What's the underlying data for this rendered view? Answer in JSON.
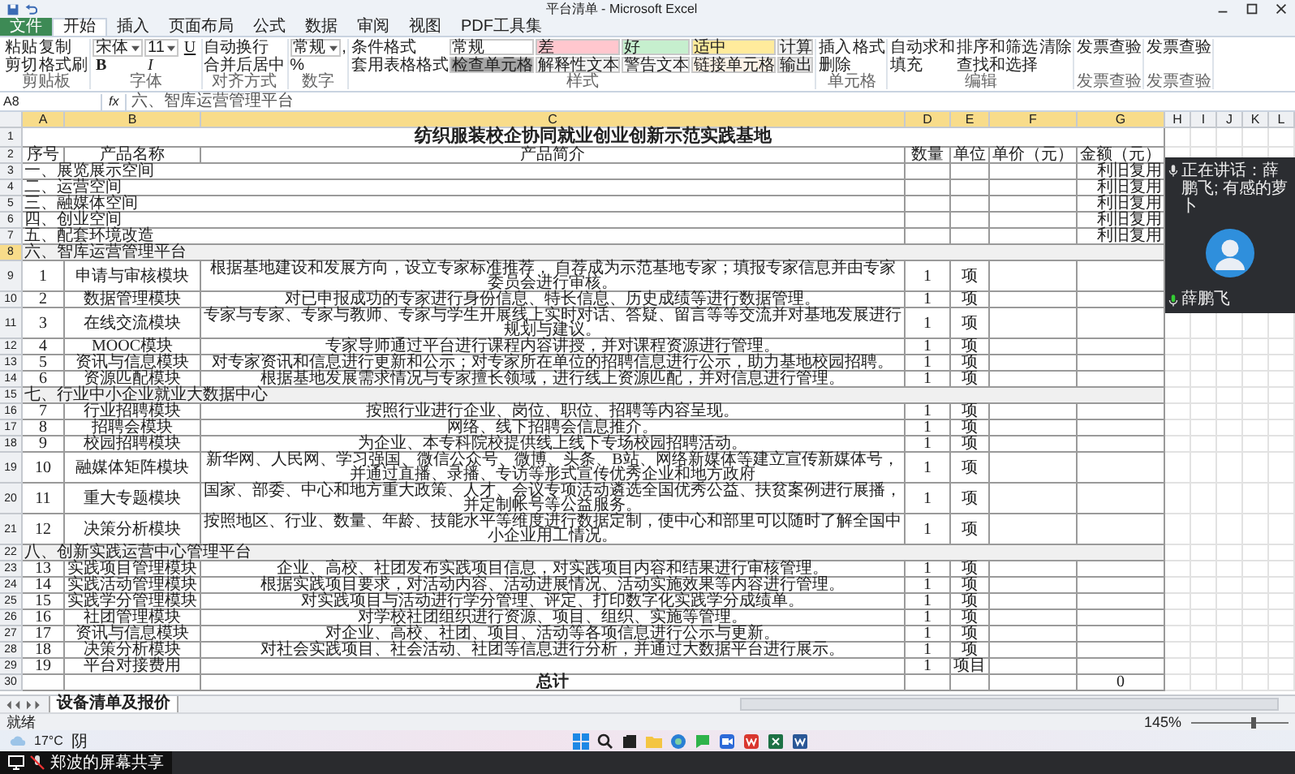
{
  "window": {
    "title": "平台清单 - Microsoft Excel"
  },
  "tabs": [
    {
      "label": "文件",
      "kind": "file",
      "selected": false
    },
    {
      "label": "开始",
      "kind": "tab",
      "selected": true
    },
    {
      "label": "插入",
      "kind": "tab",
      "selected": false
    },
    {
      "label": "页面布局",
      "kind": "tab",
      "selected": false
    },
    {
      "label": "公式",
      "kind": "tab",
      "selected": false
    },
    {
      "label": "数据",
      "kind": "tab",
      "selected": false
    },
    {
      "label": "审阅",
      "kind": "tab",
      "selected": false
    },
    {
      "label": "视图",
      "kind": "tab",
      "selected": false
    },
    {
      "label": "PDF工具集",
      "kind": "tab",
      "selected": false
    }
  ],
  "ribbon": {
    "groups": [
      {
        "label": "剪贴板",
        "items": [
          {
            "label": "粘贴",
            "kind": "button"
          },
          {
            "label": "剪切",
            "kind": "button"
          },
          {
            "label": "复制",
            "kind": "button"
          },
          {
            "label": "格式刷",
            "kind": "button"
          }
        ]
      },
      {
        "label": "字体",
        "items": [
          {
            "label": "宋体",
            "kind": "dropdown"
          },
          {
            "label": "B",
            "kind": "bold"
          },
          {
            "label": "11",
            "kind": "dropdown"
          },
          {
            "label": "I",
            "kind": "italic"
          },
          {
            "label": "U",
            "kind": "underline"
          }
        ]
      },
      {
        "label": "对齐方式",
        "items": [
          {
            "label": "自动换行",
            "kind": "button"
          },
          {
            "label": "合并后居中",
            "kind": "button"
          }
        ]
      },
      {
        "label": "数字",
        "items": [
          {
            "label": "常规",
            "kind": "dropdown"
          },
          {
            "label": "%",
            "kind": "button"
          },
          {
            "label": ",",
            "kind": "button"
          }
        ]
      },
      {
        "label": "样式",
        "items": [
          {
            "label": "条件格式",
            "kind": "button"
          },
          {
            "label": "套用表格格式",
            "kind": "button"
          },
          {
            "label": "常规",
            "kind": "style",
            "color": "#ffffff"
          },
          {
            "label": "检查单元格",
            "kind": "style",
            "color": "#a5a5a5"
          },
          {
            "label": "差",
            "kind": "style",
            "color": "#ffc7ce"
          },
          {
            "label": "解释性文本",
            "kind": "style",
            "color": "#f4f4f4"
          },
          {
            "label": "好",
            "kind": "style",
            "color": "#c6efce"
          },
          {
            "label": "警告文本",
            "kind": "style",
            "color": "#fafafa"
          },
          {
            "label": "适中",
            "kind": "style",
            "color": "#ffeb9c"
          },
          {
            "label": "链接单元格",
            "kind": "style",
            "color": "#fdf3e7"
          },
          {
            "label": "计算",
            "kind": "style",
            "color": "#f2f2f2"
          },
          {
            "label": "输出",
            "kind": "style",
            "color": "#e7e6e6"
          }
        ]
      },
      {
        "label": "单元格",
        "items": [
          {
            "label": "插入",
            "kind": "button"
          },
          {
            "label": "删除",
            "kind": "button"
          },
          {
            "label": "格式",
            "kind": "button"
          }
        ]
      },
      {
        "label": "编辑",
        "items": [
          {
            "label": "自动求和",
            "kind": "button"
          },
          {
            "label": "填充",
            "kind": "button"
          },
          {
            "label": "排序和筛选",
            "kind": "button"
          },
          {
            "label": "查找和选择",
            "kind": "button"
          },
          {
            "label": "清除",
            "kind": "button"
          }
        ]
      },
      {
        "label": "发票查验",
        "items": [
          {
            "label": "发票查验",
            "kind": "button"
          }
        ]
      },
      {
        "label": "发票查验",
        "items": [
          {
            "label": "发票查验",
            "kind": "button"
          }
        ]
      }
    ]
  },
  "formula_bar": {
    "name_box": "A8",
    "fx": "fx",
    "content": "六、智库运营管理平台"
  },
  "columns": [
    {
      "label": "A",
      "selected": true
    },
    {
      "label": "B",
      "selected": true
    },
    {
      "label": "C",
      "selected": true
    },
    {
      "label": "D",
      "selected": true
    },
    {
      "label": "E",
      "selected": true
    },
    {
      "label": "F",
      "selected": true
    },
    {
      "label": "G",
      "selected": true
    },
    {
      "label": "H",
      "selected": false
    },
    {
      "label": "I",
      "selected": false
    },
    {
      "label": "J",
      "selected": false
    },
    {
      "label": "K",
      "selected": false
    },
    {
      "label": "L",
      "selected": false
    }
  ],
  "rows": [
    {
      "num": "1",
      "kind": "title",
      "selected": false,
      "title": "纺织服装校企协同就业创业创新示范实践基地"
    },
    {
      "num": "2",
      "kind": "header",
      "selected": false,
      "a": "序号",
      "b": "产品名称",
      "c": "产品简介",
      "d": "数量",
      "e": "单位",
      "f": "单价（元）",
      "g": "金额（元）"
    },
    {
      "num": "3",
      "kind": "space",
      "selected": false,
      "a": "一、展览展示空间",
      "g": "利旧复用"
    },
    {
      "num": "4",
      "kind": "space",
      "selected": false,
      "a": "二、运营空间",
      "g": "利旧复用"
    },
    {
      "num": "5",
      "kind": "space",
      "selected": false,
      "a": "三、融媒体空间",
      "g": "利旧复用"
    },
    {
      "num": "6",
      "kind": "space",
      "selected": false,
      "a": "四、创业空间",
      "g": "利旧复用"
    },
    {
      "num": "7",
      "kind": "space",
      "selected": false,
      "a": "五、配套环境改造",
      "g": "利旧复用"
    },
    {
      "num": "8",
      "kind": "platform",
      "selected": true,
      "a": "六、智库运营管理平台"
    },
    {
      "num": "9",
      "kind": "item",
      "selected": false,
      "a": "1",
      "b": "申请与审核模块",
      "c": "根据基地建设和发展方向，设立专家标准推荐， 自荐成为示范基地专家；填报专家信息并由专家委员会进行审核。",
      "d": "1",
      "e": "项"
    },
    {
      "num": "10",
      "kind": "item",
      "selected": false,
      "a": "2",
      "b": "数据管理模块",
      "c": "对已申报成功的专家进行身份信息、特长信息、历史成绩等进行数据管理。",
      "d": "1",
      "e": "项"
    },
    {
      "num": "11",
      "kind": "item",
      "selected": false,
      "a": "3",
      "b": "在线交流模块",
      "c": "专家与专家、专家与教师、专家与学生开展线上实时对话、答疑、留言等等交流并对基地发展进行规划与建议。",
      "d": "1",
      "e": "项"
    },
    {
      "num": "12",
      "kind": "item",
      "selected": false,
      "a": "4",
      "b": "MOOC模块",
      "c": "专家导师通过平台进行课程内容讲授，并对课程资源进行管理。",
      "d": "1",
      "e": "项"
    },
    {
      "num": "13",
      "kind": "item",
      "selected": false,
      "a": "5",
      "b": "资讯与信息模块",
      "c": "对专家资讯和信息进行更新和公示；对专家所在单位的招聘信息进行公示，助力基地校园招聘。",
      "d": "1",
      "e": "项"
    },
    {
      "num": "14",
      "kind": "item",
      "selected": false,
      "a": "6",
      "b": "资源匹配模块",
      "c": "根据基地发展需求情况与专家擅长领域，进行线上资源匹配，并对信息进行管理。",
      "d": "1",
      "e": "项"
    },
    {
      "num": "15",
      "kind": "platform",
      "selected": false,
      "a": "七、行业中小企业就业大数据中心"
    },
    {
      "num": "16",
      "kind": "item",
      "selected": false,
      "a": "7",
      "b": "行业招聘模块",
      "c": "按照行业进行企业、岗位、职位、招聘等内容呈现。",
      "d": "1",
      "e": "项"
    },
    {
      "num": "17",
      "kind": "item",
      "selected": false,
      "a": "8",
      "b": "招聘会模块",
      "c": "网络、线下招聘会信息推介。",
      "d": "1",
      "e": "项"
    },
    {
      "num": "18",
      "kind": "item",
      "selected": false,
      "a": "9",
      "b": "校园招聘模块",
      "c": "为企业、本专科院校提供线上线下专场校园招聘活动。",
      "d": "1",
      "e": "项"
    },
    {
      "num": "19",
      "kind": "item",
      "selected": false,
      "a": "10",
      "b": "融媒体矩阵模块",
      "c": "新华网、人民网、学习强国、微信公众号、微博、头条、B站、网络新媒体等建立宣传新媒体号，并通过直播、录播、专访等形式宣传优秀企业和地方政府",
      "d": "1",
      "e": "项"
    },
    {
      "num": "20",
      "kind": "item",
      "selected": false,
      "a": "11",
      "b": "重大专题模块",
      "c": "国家、部委、中心和地方重大政策、人才、会议专项活动遴选全国优秀公益、扶贫案例进行展播，并定制帐号等公益服务。",
      "d": "1",
      "e": "项"
    },
    {
      "num": "21",
      "kind": "item",
      "selected": false,
      "a": "12",
      "b": "决策分析模块",
      "c": "按照地区、行业、数量、年龄、技能水平等维度进行数据定制，使中心和部里可以随时了解全国中小企业用工情况。",
      "d": "1",
      "e": "项"
    },
    {
      "num": "22",
      "kind": "platform",
      "selected": false,
      "a": "八、创新实践运营中心管理平台"
    },
    {
      "num": "23",
      "kind": "item",
      "selected": false,
      "a": "13",
      "b": "实践项目管理模块",
      "c": "企业、高校、社团发布实践项目信息，对实践项目内容和结果进行审核管理。",
      "d": "1",
      "e": "项"
    },
    {
      "num": "24",
      "kind": "item",
      "selected": false,
      "a": "14",
      "b": "实践活动管理模块",
      "c": "根据实践项目要求，对活动内容、活动进展情况、活动实施效果等内容进行管理。",
      "d": "1",
      "e": "项"
    },
    {
      "num": "25",
      "kind": "item",
      "selected": false,
      "a": "15",
      "b": "实践学分管理模块",
      "c": "对实践项目与活动进行学分管理、评定、打印数字化实践学分成绩单。",
      "d": "1",
      "e": "项"
    },
    {
      "num": "26",
      "kind": "item",
      "selected": false,
      "a": "16",
      "b": "社团管理模块",
      "c": "对学校社团组织进行资源、项目、组织、实施等管理。",
      "d": "1",
      "e": "项"
    },
    {
      "num": "27",
      "kind": "item",
      "selected": false,
      "a": "17",
      "b": "资讯与信息模块",
      "c": "对企业、高校、社团、项目、活动等各项信息进行公示与更新。",
      "d": "1",
      "e": "项"
    },
    {
      "num": "28",
      "kind": "item",
      "selected": false,
      "a": "18",
      "b": "决策分析模块",
      "c": "对社会实践项目、社会活动、社团等信息进行分析，并通过大数据平台进行展示。",
      "d": "1",
      "e": "项"
    },
    {
      "num": "29",
      "kind": "item",
      "selected": false,
      "a": "19",
      "b": "平台对接费用",
      "d": "1",
      "e": "项目"
    },
    {
      "num": "30",
      "kind": "total",
      "selected": false,
      "c": "总计",
      "g": "0"
    }
  ],
  "call_overlay": {
    "speaking": "正在讲话：薛鹏飞; 有感的萝卜",
    "participant": "薛鹏飞"
  },
  "sheet_tabs": [
    {
      "label": "设备清单及报价",
      "selected": true
    }
  ],
  "status_bar": {
    "status": "就绪",
    "zoom": {
      "label": "145%",
      "level": 0.62
    }
  },
  "taskbar": {
    "temperature": "17°C",
    "weather": "阴"
  },
  "share_bar": {
    "label": "郑波的屏幕共享"
  }
}
